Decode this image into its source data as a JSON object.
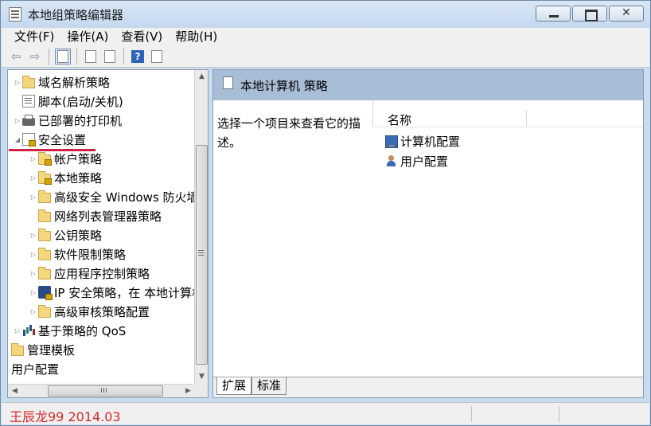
{
  "window": {
    "title": "本地组策略编辑器"
  },
  "menu": [
    {
      "label": "文件(F)"
    },
    {
      "label": "操作(A)"
    },
    {
      "label": "查看(V)"
    },
    {
      "label": "帮助(H)"
    }
  ],
  "toolbar": {
    "back_icon": "back-arrow-icon",
    "forward_icon": "forward-arrow-icon",
    "help_glyph": "?"
  },
  "tree": [
    {
      "label": "域名解析策略",
      "icon": "folder-icon",
      "expander": "▷"
    },
    {
      "label": "脚本(启动/关机)",
      "icon": "script-icon",
      "expander": ""
    },
    {
      "label": "已部署的打印机",
      "icon": "printer-icon",
      "expander": "▷"
    },
    {
      "label": "安全设置",
      "icon": "security-settings-icon",
      "expander": "◢"
    },
    {
      "label": "帐户策略",
      "icon": "locked-folder-icon",
      "expander": "▷"
    },
    {
      "label": "本地策略",
      "icon": "locked-folder-icon",
      "expander": "▷"
    },
    {
      "label": "高级安全 Windows 防火墙",
      "icon": "folder-icon",
      "expander": "▷"
    },
    {
      "label": "网络列表管理器策略",
      "icon": "folder-icon",
      "expander": ""
    },
    {
      "label": "公钥策略",
      "icon": "folder-icon",
      "expander": "▷"
    },
    {
      "label": "软件限制策略",
      "icon": "folder-icon",
      "expander": "▷"
    },
    {
      "label": "应用程序控制策略",
      "icon": "folder-icon",
      "expander": "▷"
    },
    {
      "label": "IP 安全策略，在 本地计算机",
      "icon": "ip-security-icon",
      "expander": "▷"
    },
    {
      "label": "高级审核策略配置",
      "icon": "folder-icon",
      "expander": "▷"
    },
    {
      "label": "基于策略的 QoS",
      "icon": "qos-chart-icon",
      "expander": "▷"
    },
    {
      "label": "管理模板",
      "icon": "folder-icon",
      "expander": ""
    },
    {
      "label": "用户配置",
      "icon": "",
      "expander": ""
    }
  ],
  "scrollbars": {
    "up": "▲",
    "down": "▼",
    "left": "◀",
    "right": "▶"
  },
  "details": {
    "header_title": "本地计算机 策略",
    "description": "选择一个项目来查看它的描述。",
    "column_name": "名称",
    "items": [
      {
        "label": "计算机配置",
        "icon": "computer-config-icon"
      },
      {
        "label": "用户配置",
        "icon": "user-config-icon"
      }
    ]
  },
  "tabs": [
    {
      "label": "扩展"
    },
    {
      "label": "标准"
    }
  ],
  "status": {
    "text": "王辰龙99 2014.03"
  },
  "colors": {
    "annotation_underline": "#cc2244",
    "status_text": "#d42a2a",
    "details_header": "#a8bdd6"
  }
}
